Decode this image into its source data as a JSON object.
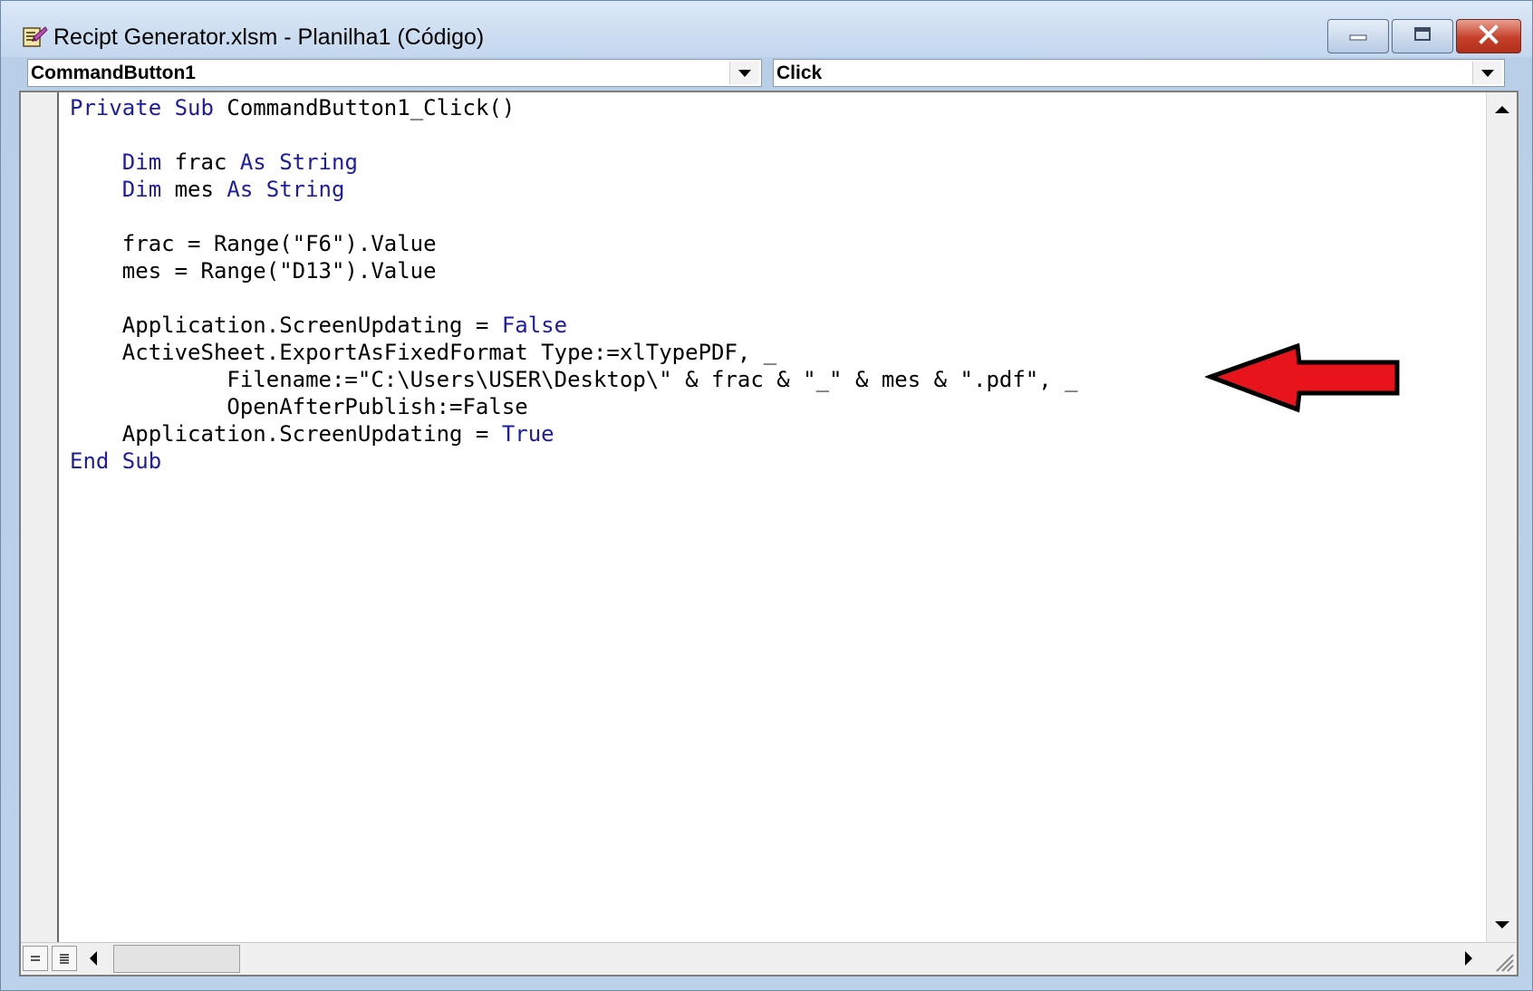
{
  "window": {
    "title": "Recipt Generator.xlsm - Planilha1 (Código)",
    "icon": "vba-module-icon",
    "controls": [
      "minimize-icon",
      "maximize-icon",
      "close-icon"
    ]
  },
  "object_combo": {
    "value": "CommandButton1"
  },
  "procedure_combo": {
    "value": "Click"
  },
  "code": {
    "lines": [
      [
        {
          "t": "Private Sub",
          "kw": true
        },
        {
          "t": " CommandButton1_Click()"
        }
      ],
      [],
      [
        {
          "t": "    "
        },
        {
          "t": "Dim",
          "kw": true
        },
        {
          "t": " frac "
        },
        {
          "t": "As String",
          "kw": true
        }
      ],
      [
        {
          "t": "    "
        },
        {
          "t": "Dim",
          "kw": true
        },
        {
          "t": " mes "
        },
        {
          "t": "As String",
          "kw": true
        }
      ],
      [],
      [
        {
          "t": "    frac = Range(\"F6\").Value"
        }
      ],
      [
        {
          "t": "    mes = Range(\"D13\").Value"
        }
      ],
      [],
      [
        {
          "t": "    Application.ScreenUpdating = "
        },
        {
          "t": "False",
          "kw": true
        }
      ],
      [
        {
          "t": "    ActiveSheet.ExportAsFixedFormat Type:=xlTypePDF, _"
        }
      ],
      [
        {
          "t": "            Filename:=\"C:\\Users\\USER\\Desktop\\\" & frac & \"_\" & mes & \".pdf\", _"
        }
      ],
      [
        {
          "t": "            OpenAfterPublish:=False"
        }
      ],
      [
        {
          "t": "    Application.ScreenUpdating = "
        },
        {
          "t": "True",
          "kw": true
        }
      ],
      [
        {
          "t": "End Sub",
          "kw": true
        }
      ]
    ]
  },
  "colors": {
    "keyword": "#1d1da2",
    "annotation_arrow": "#e8141b"
  }
}
